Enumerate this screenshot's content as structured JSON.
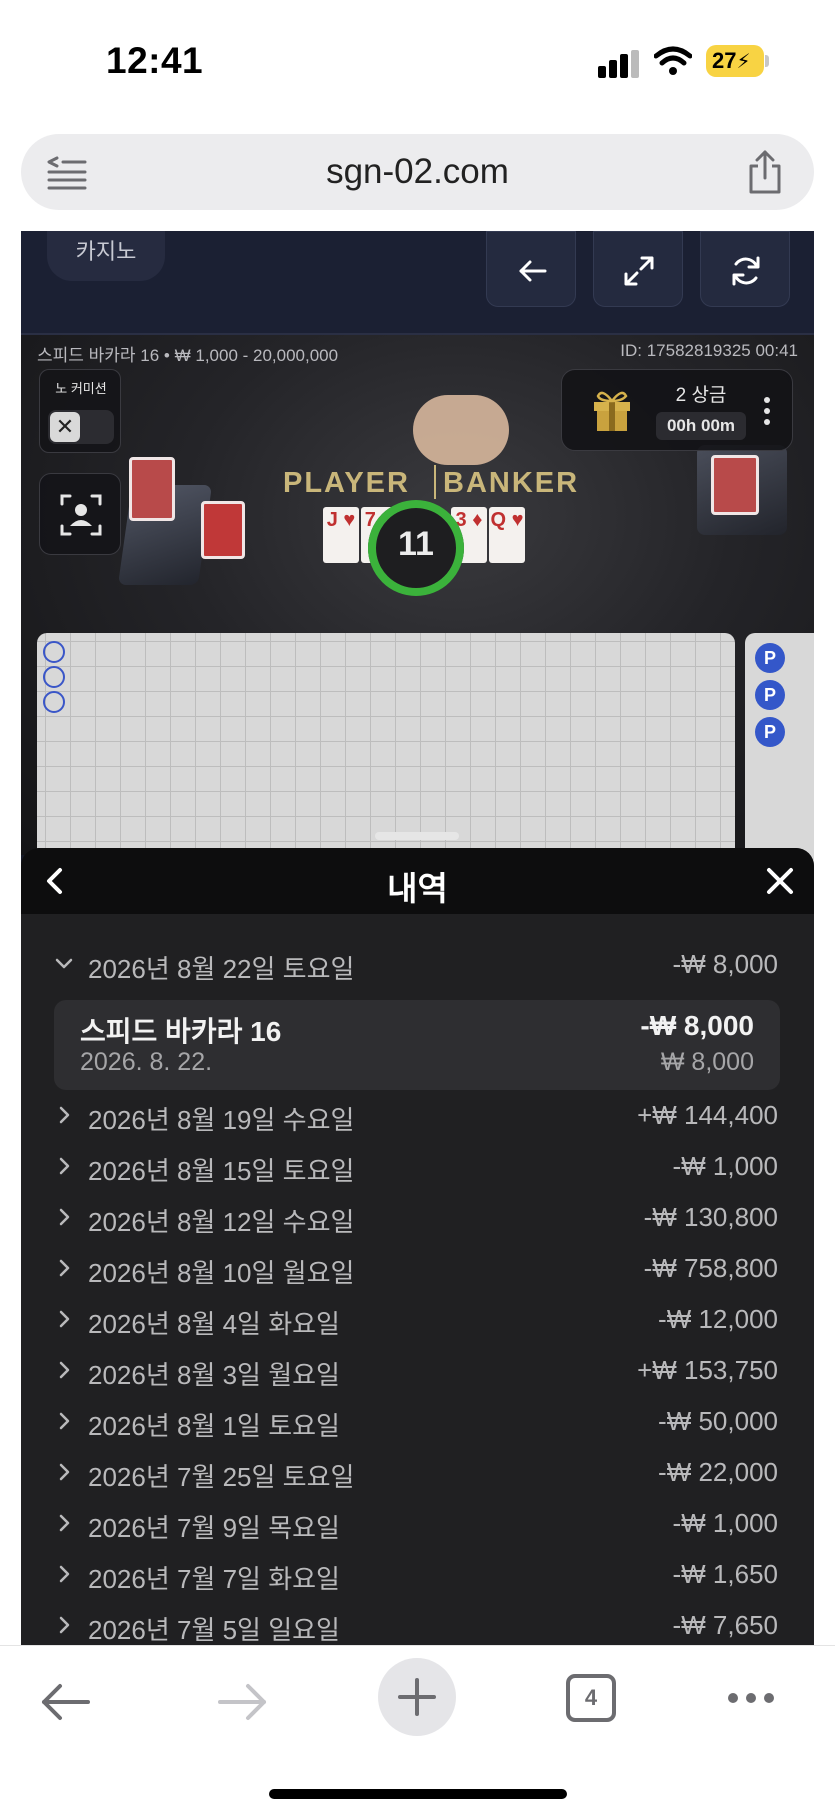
{
  "status_bar": {
    "time": "12:41",
    "battery": "27",
    "battery_color": "#f8d343"
  },
  "browser": {
    "url": "sgn-02.com",
    "tab_count": "4"
  },
  "game": {
    "casino_tab": "카지노",
    "table_info": "스피드 바카라 16 • ₩ 1,000 - 20,000,000",
    "round_id": "ID: 17582819325 00:41",
    "no_commission_label": "노 커미션",
    "toggle_off_symbol": "✕",
    "prize_title": "2 상금",
    "prize_timer": "00h 00m",
    "table_player": "PLAYER",
    "table_banker": "BANKER",
    "countdown": "11",
    "player_cards": [
      "J ♥",
      "7 ♥"
    ],
    "banker_cards": [
      "3 ♦",
      "Q ♥"
    ],
    "side_road_badge": "P",
    "accent_green": "#3bb23b"
  },
  "history": {
    "title": "내역",
    "expanded_day": {
      "label": "2026년 8월 22일 토요일",
      "amount": "-₩ 8,000"
    },
    "detail": {
      "game": "스피드 바카라 16",
      "date": "2026. 8. 22.",
      "net": "-₩ 8,000",
      "stake": "₩ 8,000"
    },
    "days": [
      {
        "label": "2026년 8월 19일 수요일",
        "amount": "+₩ 144,400"
      },
      {
        "label": "2026년 8월 15일 토요일",
        "amount": "-₩ 1,000"
      },
      {
        "label": "2026년 8월 12일 수요일",
        "amount": "-₩ 130,800"
      },
      {
        "label": "2026년 8월 10일 월요일",
        "amount": "-₩ 758,800"
      },
      {
        "label": "2026년 8월 4일 화요일",
        "amount": "-₩ 12,000"
      },
      {
        "label": "2026년 8월 3일 월요일",
        "amount": "+₩ 153,750"
      },
      {
        "label": "2026년 8월 1일 토요일",
        "amount": "-₩ 50,000"
      },
      {
        "label": "2026년 7월 25일 토요일",
        "amount": "-₩ 22,000"
      },
      {
        "label": "2026년 7월 9일 목요일",
        "amount": "-₩ 1,000"
      },
      {
        "label": "2026년 7월 7일 화요일",
        "amount": "-₩ 1,650"
      },
      {
        "label": "2026년 7월 5일 일요일",
        "amount": "-₩ 7,650"
      }
    ]
  },
  "icons": {
    "status": [
      "cellular-signal-icon",
      "wifi-icon",
      "battery-charging-icon"
    ],
    "address": [
      "reader-mode-icon",
      "share-icon"
    ],
    "header": [
      "back-arrow-icon",
      "fullscreen-icon",
      "refresh-icon"
    ],
    "toolbar": [
      "back-icon",
      "forward-icon",
      "plus-icon",
      "tabs-icon",
      "more-icon"
    ]
  }
}
